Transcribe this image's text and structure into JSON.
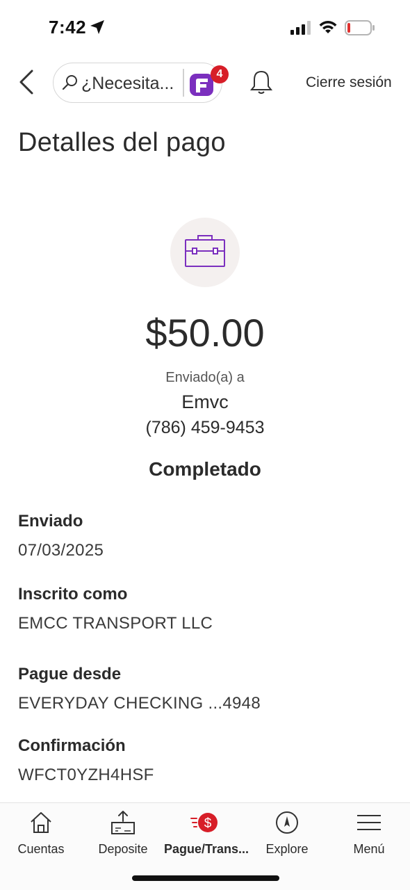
{
  "status_bar": {
    "time": "7:42"
  },
  "header": {
    "search_placeholder": "¿Necesita...",
    "notification_count": "4",
    "logout_label": "Cierre sesión"
  },
  "page": {
    "title": "Detalles del pago"
  },
  "payment": {
    "amount": "$50.00",
    "sent_to_label": "Enviado(a) a",
    "recipient_name": "Emvc",
    "recipient_phone": "(786) 459-9453",
    "status": "Completado"
  },
  "details": [
    {
      "label": "Enviado",
      "value": "07/03/2025"
    },
    {
      "label": "Inscrito como",
      "value": "EMCC TRANSPORT LLC"
    },
    {
      "label": "Pague desde",
      "value": "EVERYDAY CHECKING ...4948"
    },
    {
      "label": "Confirmación",
      "value": "WFCT0YZH4HSF"
    }
  ],
  "nav": {
    "items": [
      {
        "label": "Cuentas",
        "icon": "home-icon"
      },
      {
        "label": "Deposite",
        "icon": "deposit-icon"
      },
      {
        "label": "Pague/Trans...",
        "icon": "pay-transfer-icon"
      },
      {
        "label": "Explore",
        "icon": "compass-icon"
      },
      {
        "label": "Menú",
        "icon": "menu-icon"
      }
    ]
  },
  "colors": {
    "accent_red": "#d71e28",
    "purple": "#7b2fbe",
    "text": "#2b2b2b"
  }
}
